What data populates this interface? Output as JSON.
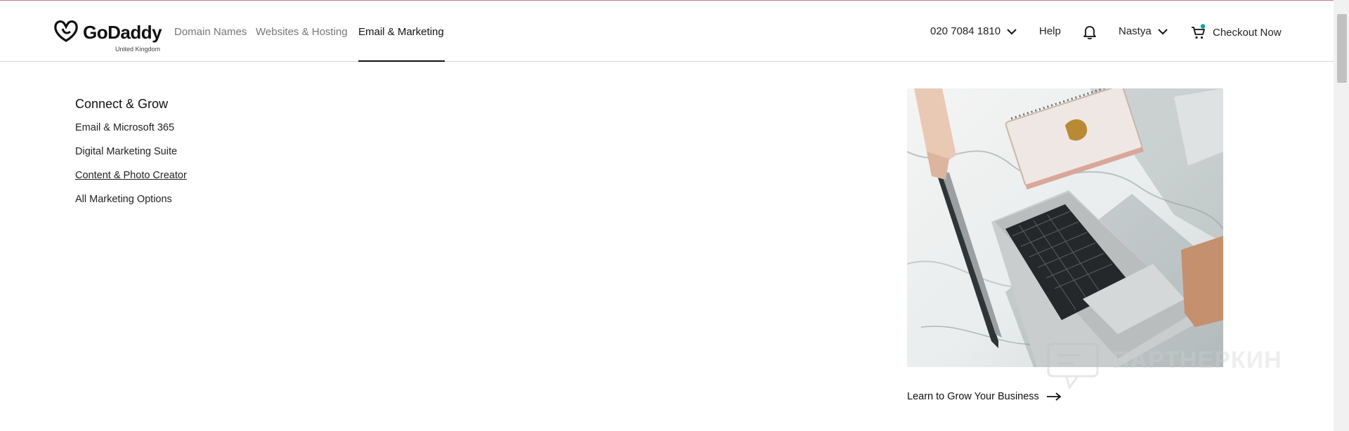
{
  "brand": {
    "name": "GoDaddy",
    "region": "United Kingdom"
  },
  "nav": {
    "items": [
      {
        "label": "Domain Names"
      },
      {
        "label": "Websites & Hosting"
      },
      {
        "label": "Email & Marketing"
      }
    ],
    "active_index": 2
  },
  "header_right": {
    "phone": "020 7084 1810",
    "help": "Help",
    "user": "Nastya",
    "checkout": "Checkout Now"
  },
  "menu": {
    "section_title": "Connect & Grow",
    "links": [
      "Email & Microsoft 365",
      "Digital Marketing Suite",
      "Content & Photo Creator",
      "All Marketing Options"
    ]
  },
  "promo": {
    "link": "Learn to Grow Your Business"
  },
  "watermark": {
    "text": "ПАРТНЕРКИН"
  },
  "colors": {
    "accent_teal": "#1bdbdb",
    "cart_badge": "#00a4a6",
    "text": "#111111",
    "muted": "#767676"
  },
  "icons": [
    "godaddy-logo-icon",
    "chevron-down-icon",
    "bell-icon",
    "cart-icon",
    "arrow-right-icon"
  ]
}
